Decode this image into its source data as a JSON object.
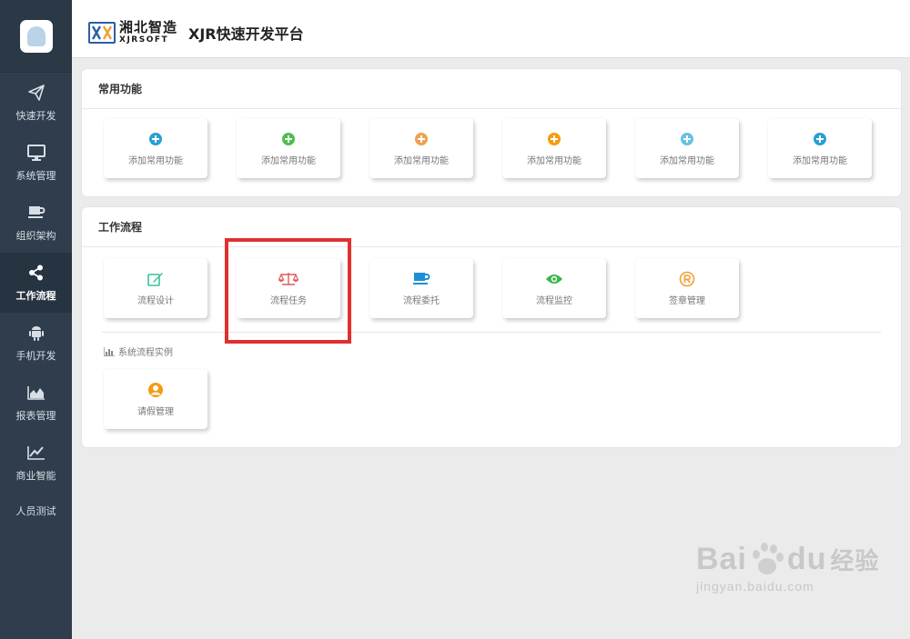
{
  "header": {
    "brand_cn": "湘北智造",
    "brand_en": "XJRSOFT",
    "platform_title": "XJR快速开发平台"
  },
  "sidebar": {
    "items": [
      {
        "label": "快速开发",
        "icon": "paper-plane-icon"
      },
      {
        "label": "系统管理",
        "icon": "monitor-icon"
      },
      {
        "label": "组织架构",
        "icon": "coffee-cup-icon"
      },
      {
        "label": "工作流程",
        "icon": "share-icon",
        "active": true
      },
      {
        "label": "手机开发",
        "icon": "android-icon"
      },
      {
        "label": "报表管理",
        "icon": "area-chart-icon"
      },
      {
        "label": "商业智能",
        "icon": "line-chart-icon"
      },
      {
        "label": "人员测试"
      }
    ]
  },
  "common": {
    "title": "常用功能",
    "tiles": [
      {
        "label": "添加常用功能",
        "color": "#2a9fd6"
      },
      {
        "label": "添加常用功能",
        "color": "#4cbf4c"
      },
      {
        "label": "添加常用功能",
        "color": "#f0a050"
      },
      {
        "label": "添加常用功能",
        "color": "#f39c12"
      },
      {
        "label": "添加常用功能",
        "color": "#66c2e6"
      },
      {
        "label": "添加常用功能",
        "color": "#2a9fd6"
      }
    ]
  },
  "workflow": {
    "title": "工作流程",
    "tiles": [
      {
        "label": "流程设计",
        "icon": "edit-icon",
        "color": "#3cc0a0"
      },
      {
        "label": "流程任务",
        "icon": "balance-scale-icon",
        "color": "#e05a5a"
      },
      {
        "label": "流程委托",
        "icon": "coffee-cup-icon",
        "color": "#1e8fd6"
      },
      {
        "label": "流程监控",
        "icon": "eye-icon",
        "color": "#3cb54a"
      },
      {
        "label": "签章管理",
        "icon": "registered-icon",
        "color": "#f0a030"
      }
    ],
    "subsection_title": "系统流程实例",
    "example_tiles": [
      {
        "label": "请假管理",
        "icon": "user-circle-icon",
        "color": "#f39c12"
      }
    ]
  },
  "watermark": {
    "main_a": "Bai",
    "main_b": "du",
    "cn": "经验",
    "url": "jingyan.baidu.com"
  }
}
